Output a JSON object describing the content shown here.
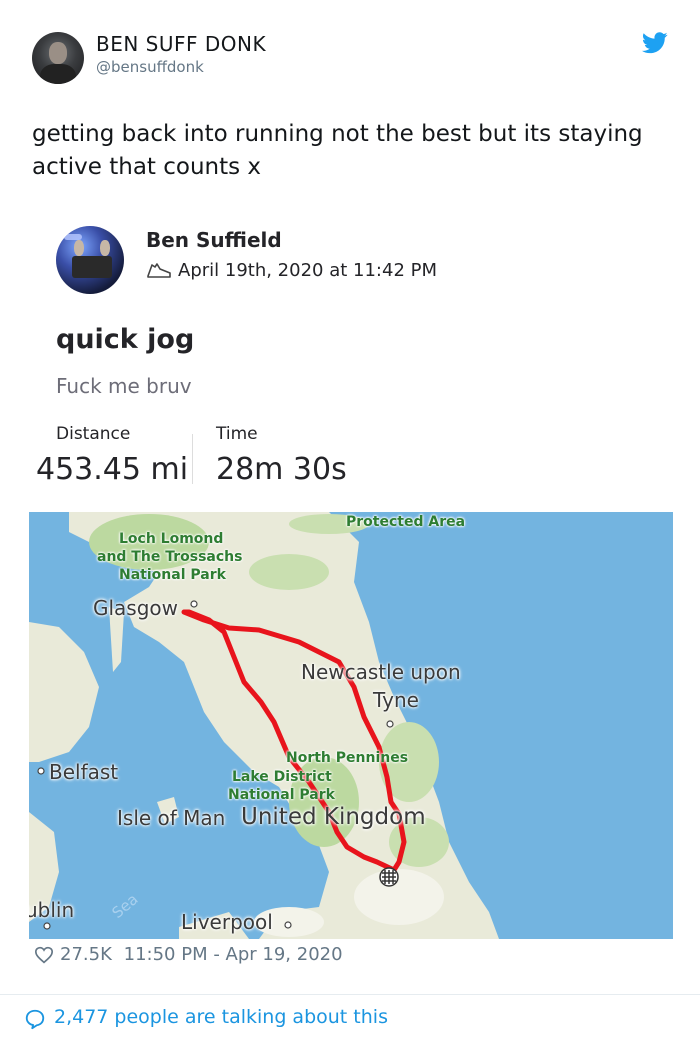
{
  "tweet": {
    "author_name": "BEN SUFF DONK",
    "author_handle": "@bensuffdonk",
    "text": "getting back into running not the best but its staying active that counts x",
    "likes": "27.5K",
    "timestamp": "11:50 PM - Apr 19, 2020",
    "talking": "2,477 people are talking about this",
    "brand_color": "#1da1f2"
  },
  "activity": {
    "athlete_name": "Ben Suffield",
    "date": "April 19th, 2020 at 11:42 PM",
    "title": "quick jog",
    "description": "Fuck me bruv",
    "stats": [
      {
        "label": "Distance",
        "value": "453.45 mi"
      },
      {
        "label": "Time",
        "value": "28m 30s"
      }
    ],
    "route_color": "#e8141c"
  },
  "map": {
    "labels": {
      "protected_area": "Protected Area",
      "loch_lomond": [
        "Loch Lomond",
        "and The Trossachs",
        "National Park"
      ],
      "glasgow": "Glasgow",
      "newcastle": [
        "Newcastle upon",
        "Tyne"
      ],
      "belfast": "Belfast",
      "north_pennines": "North Pennines",
      "lake_district": [
        "Lake District",
        "National Park"
      ],
      "isle_of_man": "Isle of Man",
      "united_kingdom": "United Kingdom",
      "dublin": "ublin",
      "irish_sea": "Sea",
      "liverpool": "Liverpool"
    }
  },
  "icons": {
    "twitter": "twitter-bird-icon",
    "shoe": "shoe-icon",
    "heart": "heart-icon",
    "comment": "comment-bubble-icon"
  }
}
